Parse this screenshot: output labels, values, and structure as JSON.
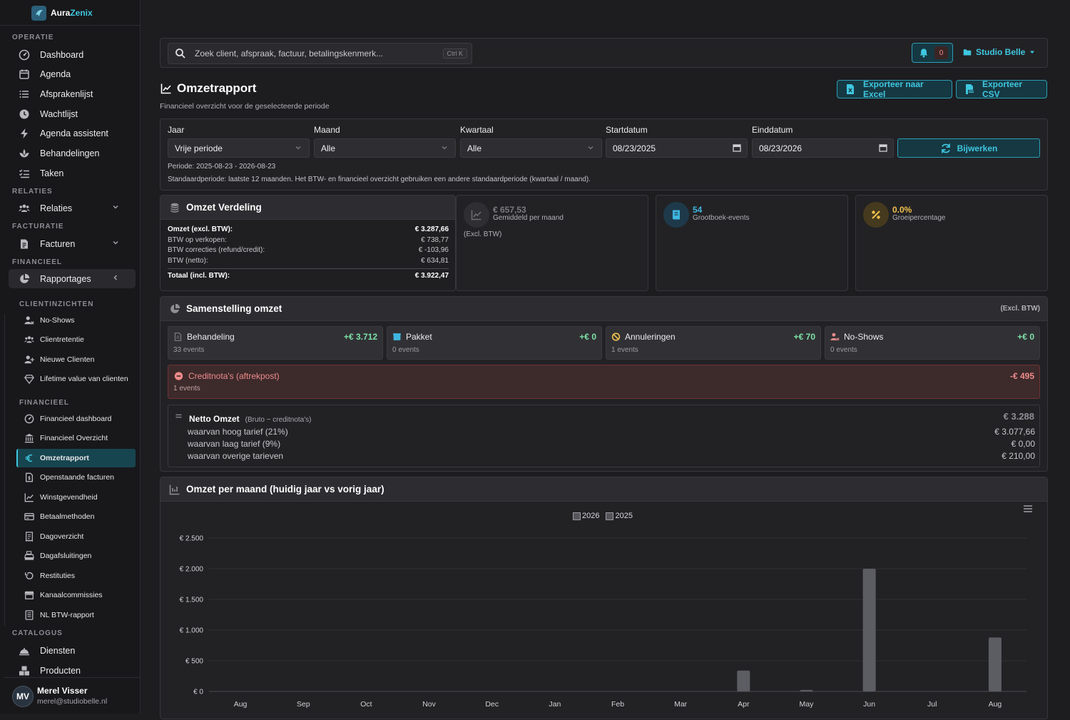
{
  "brand": {
    "name_a": "Aura",
    "name_b": "Zenix"
  },
  "sidebar": {
    "sections": {
      "operatie": "OPERATIE",
      "relaties": "RELATIES",
      "facturatie": "FACTURATIE",
      "financieel": "FINANCIEEL",
      "catalogus": "CATALOGUS"
    },
    "items": [
      {
        "label": "Dashboard",
        "icon": "dashboard-icon"
      },
      {
        "label": "Agenda",
        "icon": "calendar-icon"
      },
      {
        "label": "Afsprakenlijst",
        "icon": "list-icon"
      },
      {
        "label": "Wachtlijst",
        "icon": "clock-icon"
      },
      {
        "label": "Agenda assistent",
        "icon": "bolt-icon"
      },
      {
        "label": "Behandelingen",
        "icon": "spa-icon"
      },
      {
        "label": "Taken",
        "icon": "tasks-icon"
      },
      {
        "label": "Relaties",
        "icon": "users-icon"
      },
      {
        "label": "Facturen",
        "icon": "invoice-icon"
      },
      {
        "label": "Rapportages",
        "icon": "pie-icon"
      },
      {
        "label": "Diensten",
        "icon": "service-bell-icon"
      },
      {
        "label": "Producten",
        "icon": "boxes-icon"
      }
    ],
    "report_groups": {
      "clientinzichten": "CLIENTINZICHTEN",
      "financieel": "FINANCIEEL"
    },
    "report_items": [
      {
        "label": "No-Shows"
      },
      {
        "label": "Clientretentie"
      },
      {
        "label": "Nieuwe Clienten"
      },
      {
        "label": "Lifetime value van clienten"
      },
      {
        "label": "Financieel dashboard"
      },
      {
        "label": "Financieel Overzicht"
      },
      {
        "label": "Omzetrapport",
        "active": true
      },
      {
        "label": "Openstaande facturen"
      },
      {
        "label": "Winstgevendheid"
      },
      {
        "label": "Betaalmethoden"
      },
      {
        "label": "Dagoverzicht"
      },
      {
        "label": "Dagafsluitingen"
      },
      {
        "label": "Restituties"
      },
      {
        "label": "Kanaalcommissies"
      },
      {
        "label": "NL BTW-rapport"
      }
    ]
  },
  "user": {
    "initials": "MV",
    "name": "Merel Visser",
    "email": "merel@studiobelle.nl"
  },
  "topbar": {
    "search_placeholder": "Zoek client, afspraak, factuur, betalingskenmerk...",
    "search_shortcut": "Ctrl K",
    "notification_count": "0",
    "studio": "Studio Belle"
  },
  "page": {
    "title": "Omzetrapport",
    "subtitle": "Financieel overzicht voor de geselecteerde periode",
    "export_excel": "Exporteer naar Excel",
    "export_csv": "Exporteer CSV"
  },
  "filters": {
    "jaar_label": "Jaar",
    "jaar_value": "Vrije periode",
    "maand_label": "Maand",
    "maand_value": "Alle",
    "kwartaal_label": "Kwartaal",
    "kwartaal_value": "Alle",
    "start_label": "Startdatum",
    "start_value": "08/23/2025",
    "eind_label": "Einddatum",
    "eind_value": "08/23/2026",
    "refresh": "Bijwerken",
    "periode": "Periode: 2025-08-23 - 2026-08-23",
    "standaard": "Standaardperiode: laatste 12 maanden. Het BTW- en financieel overzicht gebruiken een andere standaardperiode (kwartaal / maand)."
  },
  "verdeling": {
    "title": "Omzet Verdeling",
    "rows": [
      {
        "label": "Omzet (excl. BTW):",
        "value": "€ 3.287,66"
      },
      {
        "label": "BTW op verkopen:",
        "value": "€ 738,77"
      },
      {
        "label": "BTW correcties (refund/credit):",
        "value": "€ -103,96"
      },
      {
        "label": "BTW (netto):",
        "value": "€ 634,81"
      }
    ],
    "total_label": "Totaal (incl. BTW):",
    "total_value": "€ 3.922,47"
  },
  "kpis": [
    {
      "value": "€ 657,53",
      "label": "Gemiddeld per maand",
      "note": "(Excl. BTW)",
      "color": "#7a7a80"
    },
    {
      "value": "54",
      "label": "Grootboek-events",
      "color": "#3fb6e0"
    },
    {
      "value": "0.0%",
      "label": "Groeipercentage",
      "color": "#f2c14e"
    }
  ],
  "samenstelling": {
    "title": "Samenstelling omzet",
    "excl": "(Excl. BTW)",
    "items": [
      {
        "label": "Behandeling",
        "value": "+€ 3.712",
        "events": "33 events"
      },
      {
        "label": "Pakket",
        "value": "+€ 0",
        "events": "0 events"
      },
      {
        "label": "Annuleringen",
        "value": "+€ 70",
        "events": "1 events"
      },
      {
        "label": "No-Shows",
        "value": "+€ 0",
        "events": "0 events"
      }
    ],
    "credit": {
      "label": "Creditnota's (aftrekpost)",
      "value": "-€ 495",
      "events": "1 events"
    },
    "netto": {
      "title": "Netto Omzet",
      "subtitle": "(Bruto − creditnota's)",
      "value": "€ 3.288",
      "rows": [
        {
          "label": "waarvan hoog tarief (21%)",
          "value": "€ 3.077,66"
        },
        {
          "label": "waarvan laag tarief (9%)",
          "value": "€ 0,00"
        },
        {
          "label": "waarvan overige tarieven",
          "value": "€ 210,00"
        }
      ]
    }
  },
  "chart_section_title": "Omzet per maand (huidig jaar vs vorig jaar)",
  "chart_data": {
    "type": "bar",
    "categories": [
      "Aug",
      "Sep",
      "Oct",
      "Nov",
      "Dec",
      "Jan",
      "Feb",
      "Mar",
      "Apr",
      "May",
      "Jun",
      "Jul",
      "Aug"
    ],
    "series": [
      {
        "name": "2026",
        "values": [
          0,
          0,
          0,
          0,
          0,
          0,
          0,
          0,
          340,
          25,
          2000,
          0,
          880
        ]
      },
      {
        "name": "2025",
        "values": [
          0,
          0,
          0,
          0,
          0,
          0,
          0,
          0,
          0,
          0,
          0,
          0,
          0
        ]
      }
    ],
    "y_ticks": [
      "€ 0",
      "€ 500",
      "€ 1.000",
      "€ 1.500",
      "€ 2.000",
      "€ 2.500"
    ],
    "ylim": [
      0,
      2500
    ],
    "legend_position": "top-center",
    "grid": true,
    "bar_color": "#5c5c63"
  }
}
